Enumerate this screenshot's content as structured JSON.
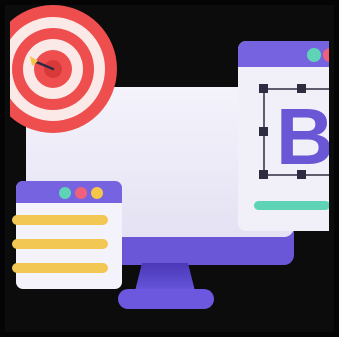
{
  "illustration": {
    "design_card_letter": "B",
    "colors": {
      "background": "#0c0c0c",
      "monitor_screen": "#eeedf7",
      "monitor_bezel": "#6a57d8",
      "stand": "#5b47cc",
      "card_header": "#7663e0",
      "card_body": "#f1f0f9",
      "dot_teal": "#5ed3b6",
      "dot_pink": "#f0607a",
      "dot_yellow": "#f3c64a",
      "list_bar": "#f2c754",
      "target_red": "#ef4e4e",
      "target_white": "#fbe9e7",
      "letter_purple": "#6957d6",
      "progress_teal": "#5ed3b6",
      "arrow": "#2c2a44"
    },
    "list_item_count": 3
  }
}
